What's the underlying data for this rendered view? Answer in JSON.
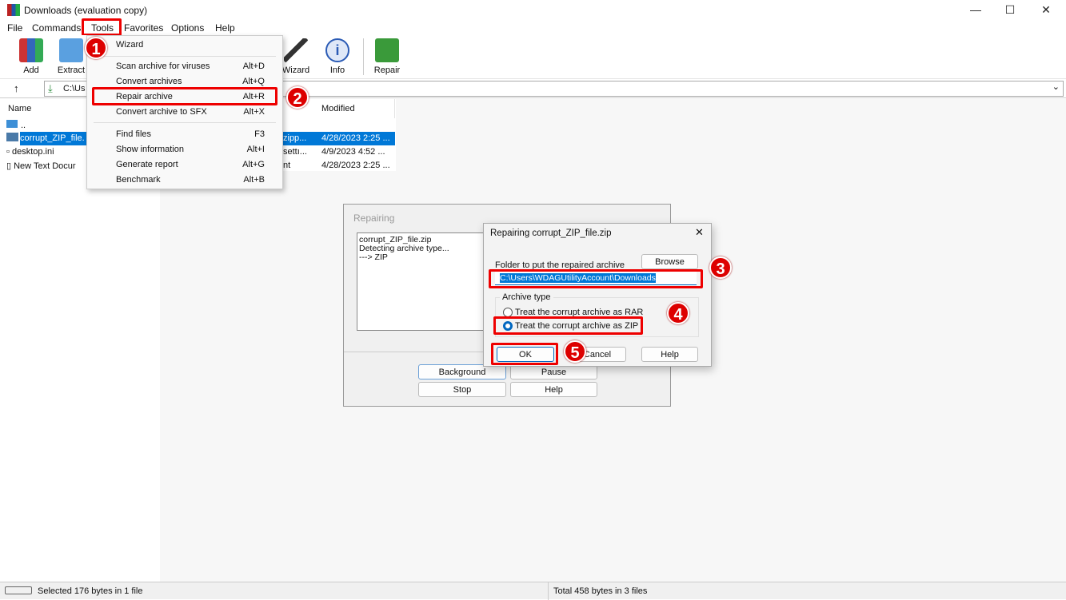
{
  "window": {
    "title": "Downloads (evaluation copy)",
    "minimize": "—",
    "maximize": "☐",
    "close": "✕"
  },
  "menubar": [
    "File",
    "Commands",
    "Tools",
    "Favorites",
    "Options",
    "Help"
  ],
  "toolbar": [
    {
      "label": "Add",
      "icon": "add-archive-icon"
    },
    {
      "label": "Extract",
      "icon": "extract-folder-icon"
    },
    {
      "label": "Wizard",
      "icon": "wizard-wand-icon"
    },
    {
      "label": "Info",
      "icon": "info-icon"
    },
    {
      "label": "Repair",
      "icon": "repair-icon"
    }
  ],
  "address": {
    "up": "↑",
    "path": "C:\\Us",
    "dropdown": "⌄"
  },
  "columns": {
    "name": "Name",
    "modified": "Modified"
  },
  "files": [
    {
      "name": "..",
      "type": "",
      "modified": ""
    },
    {
      "name": "corrupt_ZIP_file.",
      "type": "zipp...",
      "modified": "4/28/2023 2:25 ..."
    },
    {
      "name": "desktop.ini",
      "type": "settı...",
      "modified": "4/9/2023 4:52 ..."
    },
    {
      "name": "New Text Docur",
      "type": "nt",
      "modified": "4/28/2023 2:25 ..."
    }
  ],
  "tools_menu": [
    {
      "label": "Wizard",
      "key": ""
    },
    {
      "label": "Scan archive for viruses",
      "key": "Alt+D"
    },
    {
      "label": "Convert archives",
      "key": "Alt+Q"
    },
    {
      "label": "Repair archive",
      "key": "Alt+R"
    },
    {
      "label": "Convert archive to SFX",
      "key": "Alt+X"
    },
    {
      "label": "Find files",
      "key": "F3"
    },
    {
      "label": "Show information",
      "key": "Alt+I"
    },
    {
      "label": "Generate report",
      "key": "Alt+G"
    },
    {
      "label": "Benchmark",
      "key": "Alt+B"
    }
  ],
  "repairing": {
    "title": "Repairing",
    "log": [
      "corrupt_ZIP_file.zip",
      "Detecting archive type...",
      "---> ZIP"
    ],
    "buttons": {
      "background": "Background",
      "pause": "Pause",
      "stop": "Stop",
      "help": "Help"
    }
  },
  "dialog": {
    "title": "Repairing corrupt_ZIP_file.zip",
    "close": "✕",
    "folder_label": "Folder to put the repaired archive",
    "browse": "Browse",
    "folder_value": "C:\\Users\\WDAGUtilityAccount\\Downloads",
    "archive_type_label": "Archive type",
    "option_rar": "Treat the corrupt archive as RAR",
    "option_zip": "Treat the corrupt archive as ZIP",
    "selected": "zip",
    "ok": "OK",
    "cancel": "Cancel",
    "help": "Help"
  },
  "steps": [
    "1",
    "2",
    "3",
    "4",
    "5"
  ],
  "statusbar": {
    "left": "Selected 176 bytes in 1 file",
    "right": "Total 458 bytes in 3 files"
  },
  "colors": {
    "accent": "#0078d7",
    "highlight": "#e00000"
  }
}
